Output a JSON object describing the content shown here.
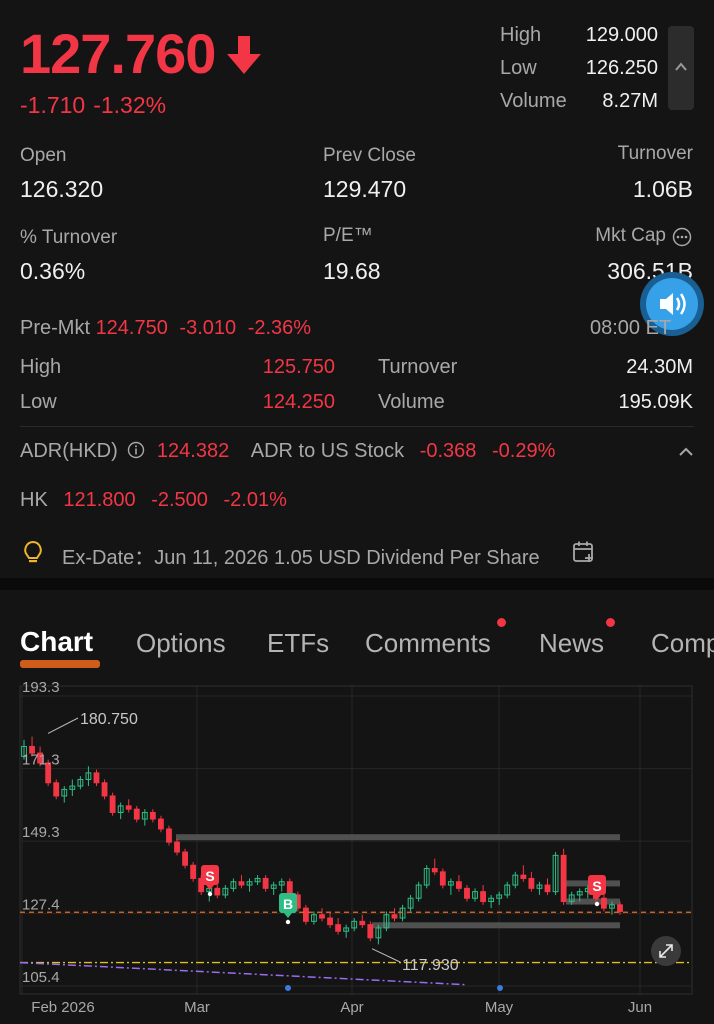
{
  "quote": {
    "price": "127.760",
    "change": "-1.710",
    "change_pct": "-1.32%",
    "high_label": "High",
    "high": "129.000",
    "low_label": "Low",
    "low": "126.250",
    "volume_label": "Volume",
    "volume": "8.27M"
  },
  "stats": {
    "open_label": "Open",
    "open": "126.320",
    "prev_close_label": "Prev Close",
    "prev_close": "129.470",
    "turnover_label": "Turnover",
    "turnover": "1.06B",
    "pct_turnover_label": "% Turnover",
    "pct_turnover": "0.36%",
    "pe_label": "P/E™",
    "pe": "19.68",
    "mkt_cap_label": "Mkt Cap",
    "mkt_cap": "306.51B"
  },
  "premarket": {
    "label": "Pre-Mkt",
    "price": "124.750",
    "change": "-3.010",
    "change_pct": "-2.36%",
    "time": "08:00 ET",
    "high_label": "High",
    "high": "125.750",
    "low_label": "Low",
    "low": "124.250",
    "turnover_label": "Turnover",
    "turnover": "24.30M",
    "volume_label": "Volume",
    "volume": "195.09K"
  },
  "adr": {
    "label": "ADR(HKD)",
    "price": "124.382",
    "to_us_label": "ADR to US Stock",
    "to_us_change": "-0.368",
    "to_us_pct": "-0.29%"
  },
  "hk": {
    "label": "HK",
    "price": "121.800",
    "change": "-2.500",
    "change_pct": "-2.01%"
  },
  "dividend": {
    "text": "Ex-Date：Jun 11, 2026 1.05 USD Dividend Per Share"
  },
  "tabs": [
    {
      "label": "Chart",
      "active": true,
      "dot": false
    },
    {
      "label": "Options",
      "active": false,
      "dot": false
    },
    {
      "label": "ETFs",
      "active": false,
      "dot": false
    },
    {
      "label": "Comments",
      "active": false,
      "dot": true
    },
    {
      "label": "News",
      "active": false,
      "dot": true
    },
    {
      "label": "Comp",
      "active": false,
      "dot": false
    }
  ],
  "colors": {
    "up": "#2ebd85",
    "down": "#f23645",
    "accent": "#f06a1a",
    "bg": "#141414"
  },
  "chart_data": {
    "type": "candlestick",
    "y_ticks": [
      "193.3",
      "171.3",
      "149.3",
      "127.4",
      "105.4"
    ],
    "x_ticks": [
      "Feb 2026",
      "Mar",
      "Apr",
      "May",
      "Jun"
    ],
    "ylim": [
      105.4,
      193.3
    ],
    "high_marker": "180.750",
    "low_marker": "117.930",
    "last_price": 127.76,
    "markers": [
      {
        "label": "S",
        "type": "sell"
      },
      {
        "label": "B",
        "type": "buy"
      },
      {
        "label": "S",
        "type": "sell"
      }
    ],
    "ohlc": [
      [
        175,
        180,
        174,
        178
      ],
      [
        178,
        181,
        175,
        176
      ],
      [
        176,
        178,
        172,
        173
      ],
      [
        173,
        174,
        166,
        167
      ],
      [
        167,
        168,
        162,
        163
      ],
      [
        163,
        166,
        161,
        165
      ],
      [
        165,
        168,
        163,
        166
      ],
      [
        166,
        169,
        165,
        168
      ],
      [
        168,
        172,
        166,
        170
      ],
      [
        170,
        171,
        166,
        167
      ],
      [
        167,
        168,
        162,
        163
      ],
      [
        163,
        164,
        157,
        158
      ],
      [
        158,
        161,
        156,
        160
      ],
      [
        160,
        162,
        158,
        159
      ],
      [
        159,
        160,
        155,
        156
      ],
      [
        156,
        159,
        154,
        158
      ],
      [
        158,
        159,
        155,
        156
      ],
      [
        156,
        157,
        152,
        153
      ],
      [
        153,
        154,
        148,
        149
      ],
      [
        149,
        150,
        145,
        146
      ],
      [
        146,
        147,
        141,
        142
      ],
      [
        142,
        143,
        137,
        138
      ],
      [
        138,
        139,
        133,
        134
      ],
      [
        134,
        136,
        131,
        135
      ],
      [
        135,
        136,
        132,
        133
      ],
      [
        133,
        136,
        132,
        135
      ],
      [
        135,
        138,
        134,
        137
      ],
      [
        137,
        139,
        135,
        136
      ],
      [
        136,
        138,
        134,
        137
      ],
      [
        137,
        139,
        136,
        138
      ],
      [
        138,
        139,
        134,
        135
      ],
      [
        135,
        137,
        133,
        136
      ],
      [
        136,
        138,
        134,
        137
      ],
      [
        137,
        138,
        132,
        133
      ],
      [
        133,
        134,
        128,
        129
      ],
      [
        129,
        130,
        124,
        125
      ],
      [
        125,
        128,
        124,
        127
      ],
      [
        127,
        129,
        125,
        126
      ],
      [
        126,
        128,
        123,
        124
      ],
      [
        124,
        126,
        121,
        122
      ],
      [
        122,
        124,
        120,
        123
      ],
      [
        123,
        126,
        122,
        125
      ],
      [
        125,
        127,
        123,
        124
      ],
      [
        124,
        125,
        119,
        120
      ],
      [
        120,
        124,
        118,
        123
      ],
      [
        123,
        128,
        122,
        127
      ],
      [
        127,
        129,
        125,
        126
      ],
      [
        126,
        130,
        125,
        129
      ],
      [
        129,
        133,
        128,
        132
      ],
      [
        132,
        137,
        131,
        136
      ],
      [
        136,
        142,
        135,
        141
      ],
      [
        141,
        144,
        139,
        140
      ],
      [
        140,
        141,
        135,
        136
      ],
      [
        136,
        138,
        133,
        137
      ],
      [
        137,
        139,
        134,
        135
      ],
      [
        135,
        136,
        131,
        132
      ],
      [
        132,
        135,
        131,
        134
      ],
      [
        134,
        136,
        130,
        131
      ],
      [
        131,
        133,
        129,
        132
      ],
      [
        132,
        134,
        130,
        133
      ],
      [
        133,
        137,
        132,
        136
      ],
      [
        136,
        140,
        135,
        139
      ],
      [
        139,
        142,
        137,
        138
      ],
      [
        138,
        140,
        134,
        135
      ],
      [
        135,
        137,
        133,
        136
      ],
      [
        136,
        138,
        133,
        134
      ],
      [
        134,
        146,
        133,
        145
      ],
      [
        145,
        147,
        130,
        131
      ],
      [
        131,
        134,
        130,
        133
      ],
      [
        133,
        135,
        131,
        134
      ],
      [
        134,
        136,
        132,
        135
      ],
      [
        135,
        136,
        131,
        132
      ],
      [
        132,
        133,
        128,
        129
      ],
      [
        129,
        131,
        127,
        130
      ],
      [
        130,
        131,
        127,
        128
      ]
    ]
  }
}
